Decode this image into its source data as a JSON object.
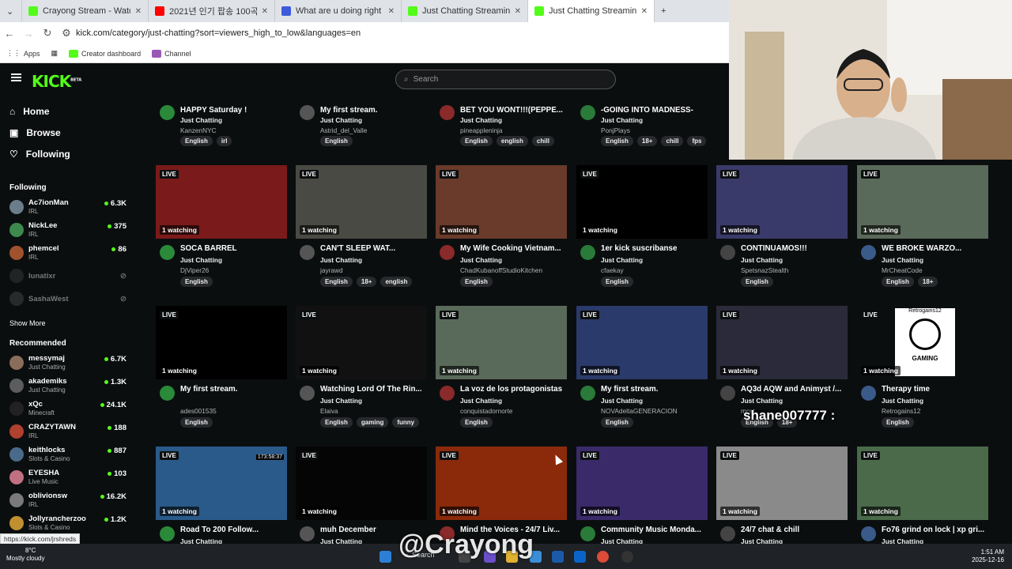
{
  "browser": {
    "tabs": [
      {
        "label": "Crayong Stream - Watch Live o",
        "color": "#53fc18"
      },
      {
        "label": "2021년 인기 팝송 100곡 모",
        "color": "#ff0000"
      },
      {
        "label": "What are u doing right now? -",
        "color": "#3b5bdb"
      },
      {
        "label": "Just Chatting Streaming - Live S",
        "color": "#53fc18"
      },
      {
        "label": "Just Chatting Streaming - Live S",
        "color": "#53fc18"
      }
    ],
    "url": "kick.com/category/just-chatting?sort=viewers_high_to_low&languages=en",
    "bookmarks": [
      "Apps",
      "Creator dashboard",
      "Channel"
    ]
  },
  "kick": {
    "logo": "KICK",
    "beta": "BETA",
    "search_placeholder": "Search",
    "nav": [
      {
        "label": "Home",
        "icon": "home-icon"
      },
      {
        "label": "Browse",
        "icon": "browse-icon"
      },
      {
        "label": "Following",
        "icon": "heart-icon"
      }
    ],
    "following_title": "Following",
    "following": [
      {
        "name": "Ac7ionMan",
        "cat": "IRL",
        "viewers": "6.3K",
        "online": true,
        "color": "#6b7d8a"
      },
      {
        "name": "NickLee",
        "cat": "IRL",
        "viewers": "375",
        "online": true,
        "color": "#3d8a4e"
      },
      {
        "name": "phemcel",
        "cat": "IRL",
        "viewers": "86",
        "online": true,
        "color": "#a0522d"
      },
      {
        "name": "lunatixr",
        "cat": "",
        "viewers": "",
        "online": false,
        "color": "#444"
      },
      {
        "name": "SashaWest",
        "cat": "",
        "viewers": "",
        "online": false,
        "color": "#555"
      }
    ],
    "show_more": "Show More",
    "recommended_title": "Recommended",
    "recommended": [
      {
        "name": "messymaj",
        "cat": "Just Chatting",
        "viewers": "6.7K",
        "color": "#8a6d5a"
      },
      {
        "name": "akademiks",
        "cat": "Just Chatting",
        "viewers": "1.3K",
        "color": "#5c5c5c"
      },
      {
        "name": "xQc",
        "cat": "Minecraft",
        "viewers": "24.1K",
        "color": "#222"
      },
      {
        "name": "CRAZYTAWN",
        "cat": "IRL",
        "viewers": "188",
        "color": "#b04030"
      },
      {
        "name": "keithlocks",
        "cat": "Slots & Casino",
        "viewers": "887",
        "color": "#4a6a8a"
      },
      {
        "name": "EYESHA",
        "cat": "Live Music",
        "viewers": "103",
        "color": "#c07080"
      },
      {
        "name": "oblivionsw",
        "cat": "IRL",
        "viewers": "16.2K",
        "color": "#7a7a7a"
      },
      {
        "name": "Jollyrancherzoo",
        "cat": "Slots & Casino",
        "viewers": "1.2K",
        "color": "#c09030"
      }
    ]
  },
  "top_row": [
    {
      "title": "HAPPY Saturday !",
      "cat": "Just Chatting",
      "user": "KanzenNYC",
      "tags": [
        "English",
        "irl"
      ]
    },
    {
      "title": "My first stream.",
      "cat": "Just Chatting",
      "user": "Astrid_del_Valle",
      "tags": [
        "English"
      ]
    },
    {
      "title": "BET YOU WONT!!!(PEPPE...",
      "cat": "Just Chatting",
      "user": "pineappleninja",
      "tags": [
        "English",
        "english",
        "chill"
      ]
    },
    {
      "title": "-GOING INTO MADNESS-",
      "cat": "Just Chatting",
      "user": "PonjPlays",
      "tags": [
        "English",
        "18+",
        "chill",
        "fps"
      ]
    }
  ],
  "rows": [
    [
      {
        "title": "SOCA BARREL",
        "cat": "Just Chatting",
        "user": "DjViper26",
        "tags": [
          "English"
        ],
        "watch": "1 watching",
        "live": "LIVE",
        "bg": "#7a1a1a"
      },
      {
        "title": "CAN'T SLEEP  WAT...",
        "cat": "Just Chatting",
        "user": "jayrawd",
        "tags": [
          "English",
          "18+",
          "english"
        ],
        "watch": "1 watching",
        "live": "LIVE",
        "bg": "#4a4a44"
      },
      {
        "title": "My Wife Cooking Vietnam...",
        "cat": "Just Chatting",
        "user": "ChadKubanoffStudioKitchen",
        "tags": [
          "English"
        ],
        "watch": "1 watching",
        "live": "LIVE",
        "bg": "#6a3a2a"
      },
      {
        "title": "1er kick suscribanse",
        "cat": "Just Chatting",
        "user": "cfaekay",
        "tags": [
          "English"
        ],
        "watch": "1 watching",
        "live": "LIVE",
        "bg": "#000000"
      },
      {
        "title": "CONTINUAMOS!!!",
        "cat": "Just Chatting",
        "user": "SpetsnazStealth",
        "tags": [
          "English"
        ],
        "watch": "1 watching",
        "live": "LIVE",
        "bg": "#3a3a6a"
      },
      {
        "title": "WE BROKE WARZO...",
        "cat": "Just Chatting",
        "user": "MrCheatCode",
        "tags": [
          "English",
          "18+"
        ],
        "watch": "1 watching",
        "live": "LIVE",
        "bg": "#5a6a5a"
      }
    ],
    [
      {
        "title": "My first stream.",
        "cat": "",
        "user": "ades001535",
        "tags": [
          "English"
        ],
        "watch": "1 watching",
        "live": "LIVE",
        "bg": "#000000"
      },
      {
        "title": "Watching Lord Of The Rin...",
        "cat": "Just Chatting",
        "user": "Elaiva",
        "tags": [
          "English",
          "gaming",
          "funny"
        ],
        "watch": "1 watching",
        "live": "LIVE",
        "bg": "#111111"
      },
      {
        "title": "La voz de los protagonistas",
        "cat": "Just Chatting",
        "user": "conquistadornorte",
        "tags": [
          "English"
        ],
        "watch": "1 watching",
        "live": "LIVE",
        "bg": "#5a6a5a"
      },
      {
        "title": "My first stream.",
        "cat": "Just Chatting",
        "user": "NOVAdeltaGENERACION",
        "tags": [
          "English"
        ],
        "watch": "1 watching",
        "live": "LIVE",
        "bg": "#2a3a6a"
      },
      {
        "title": "AQ3d AQW and Animyst /...",
        "cat": "Just Chatting",
        "user": "mcst",
        "tags": [
          "English",
          "18+"
        ],
        "watch": "1 watching",
        "live": "LIVE",
        "bg": "#2a2a3a"
      },
      {
        "title": "Therapy time",
        "cat": "Just Chatting",
        "user": "Retrogains12",
        "tags": [
          "English"
        ],
        "watch": "1 watching",
        "live": "LIVE",
        "bg": "#ffffff",
        "thumb_text": "Retrogains12",
        "thumb_text2": "GAMING"
      }
    ],
    [
      {
        "title": "Road To 200 Follow...",
        "cat": "Just Chatting",
        "user": "",
        "tags": [],
        "watch": "1 watching",
        "live": "LIVE",
        "bg": "#2a5a8a",
        "timer": "173:58:37"
      },
      {
        "title": "muh December",
        "cat": "Just Chatting",
        "user": "",
        "tags": [],
        "watch": "1 watching",
        "live": "LIVE",
        "bg": "#050505"
      },
      {
        "title": "Mind the Voices - 24/7 Liv...",
        "cat": "",
        "user": "",
        "tags": [],
        "watch": "1 watching",
        "live": "LIVE",
        "bg": "#8a2a0a"
      },
      {
        "title": "Community Music Monda...",
        "cat": "Just Chatting",
        "user": "",
        "tags": [],
        "watch": "1 watching",
        "live": "LIVE",
        "bg": "#3a2a6a"
      },
      {
        "title": "24/7 chat & chill",
        "cat": "Just Chatting",
        "user": "",
        "tags": [],
        "watch": "1 watching",
        "live": "LIVE",
        "bg": "#8a8a8a"
      },
      {
        "title": "Fo76 grind on lock | xp gri...",
        "cat": "Just Chatting",
        "user": "",
        "tags": [],
        "watch": "1 watching",
        "live": "LIVE",
        "bg": "#4a6a4a"
      }
    ]
  ],
  "overlay": {
    "chat": "shane007777 :",
    "watermark": "@Crayong",
    "status_url": "https://kick.com/jrshreds"
  },
  "taskbar": {
    "temp": "8°C",
    "weather": "Mostly cloudy",
    "search": "Search",
    "time": "1:51 AM",
    "date": "2025-12-16"
  }
}
